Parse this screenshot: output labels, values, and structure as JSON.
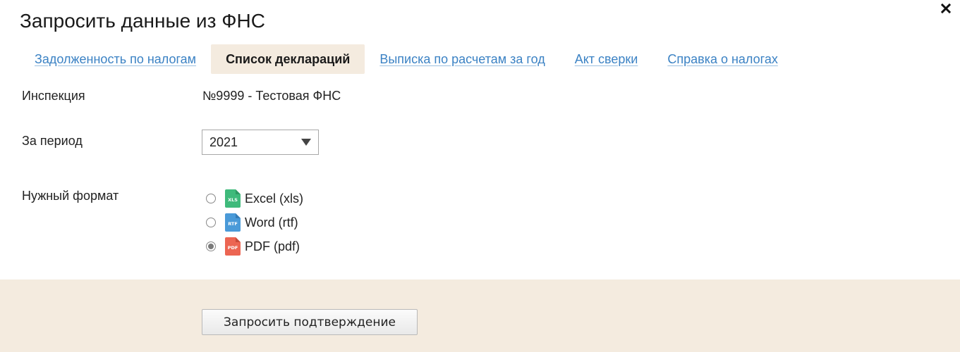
{
  "dialog": {
    "title": "Запросить данные из ФНС"
  },
  "tabs": [
    {
      "label": "Задолженность по налогам",
      "active": false
    },
    {
      "label": "Список деклараций",
      "active": true
    },
    {
      "label": "Выписка по расчетам за год",
      "active": false
    },
    {
      "label": "Акт сверки",
      "active": false
    },
    {
      "label": "Справка о налогах",
      "active": false
    }
  ],
  "form": {
    "inspection_label": "Инспекция",
    "inspection_value": "№9999 - Тестовая ФНС",
    "period_label": "За период",
    "period_value": "2021",
    "format_label": "Нужный формат",
    "formats": [
      {
        "label": "Excel (xls)",
        "icon": "xls-file-icon",
        "icon_text": "XLS",
        "color": "#3fba7b",
        "checked": false
      },
      {
        "label": "Word (rtf)",
        "icon": "rtf-file-icon",
        "icon_text": "RTF",
        "color": "#4a9ad8",
        "checked": false
      },
      {
        "label": "PDF (pdf)",
        "icon": "pdf-file-icon",
        "icon_text": "PDF",
        "color": "#ec6552",
        "checked": true
      }
    ]
  },
  "footer": {
    "submit_label": "Запросить подтверждение"
  },
  "colors": {
    "accent_link": "#3b82c4",
    "active_tab_bg": "#f4ebdf",
    "footer_bg": "#f4ebdf"
  }
}
